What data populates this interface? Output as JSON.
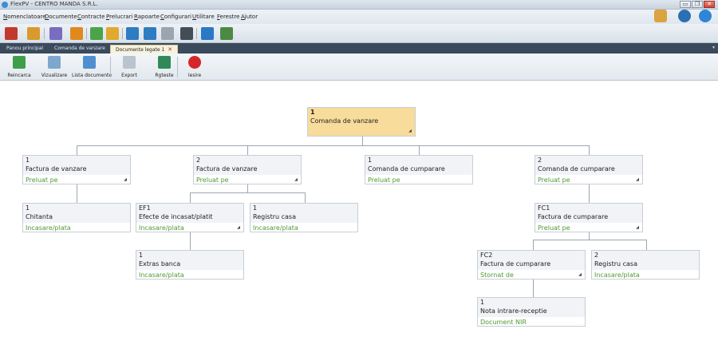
{
  "window": {
    "title": "FlexPV - CENTRO MANDA S.R.L.",
    "minimize": "▭",
    "maximize": "❐",
    "close": "✕"
  },
  "menu": [
    "Nomenclatoare",
    "Documente",
    "Contracte",
    "Prelucrari",
    "Rapoarte",
    "Configurari",
    "Utilitare",
    "Ferestre",
    "Ajutor"
  ],
  "tabs": [
    {
      "label": "Panou principal"
    },
    {
      "label": "Comanda de vanzare"
    },
    {
      "label": "Documente legate 1",
      "close": "✕"
    }
  ],
  "tab_arrow": "▾",
  "ribbon": [
    {
      "label": "Reincarca"
    },
    {
      "label": "Vizualizare"
    },
    {
      "label": "Lista documente"
    },
    {
      "label": "Export"
    },
    {
      "label": "Rgteste"
    },
    {
      "label": "Iesire"
    }
  ],
  "nodes": {
    "root": {
      "num": "1",
      "name": "Comanda de vanzare",
      "rel": ""
    },
    "fv1": {
      "num": "1",
      "name": "Factura de vanzare",
      "rel": "Preluat pe"
    },
    "fv2": {
      "num": "2",
      "name": "Factura de vanzare",
      "rel": "Preluat pe"
    },
    "cc1": {
      "num": "1",
      "name": "Comanda de cumparare",
      "rel": "Preluat pe"
    },
    "cc2": {
      "num": "2",
      "name": "Comanda de cumparare",
      "rel": "Preluat pe"
    },
    "chit": {
      "num": "1",
      "name": "Chitanta",
      "rel": "Incasare/plata"
    },
    "ef1": {
      "num": "EF1",
      "name": "Efecte de incasat/platit",
      "rel": "Incasare/plata"
    },
    "rc1": {
      "num": "1",
      "name": "Registru casa",
      "rel": "Incasare/plata"
    },
    "fc1": {
      "num": "FC1",
      "name": "Factura de cumparare",
      "rel": "Preluat pe"
    },
    "eb": {
      "num": "1",
      "name": "Extras banca",
      "rel": "Incasare/plata"
    },
    "fc2": {
      "num": "FC2",
      "name": "Factura de cumparare",
      "rel": "Stornat de"
    },
    "rc2": {
      "num": "2",
      "name": "Registru casa",
      "rel": "Incasare/plata"
    },
    "nir": {
      "num": "1",
      "name": "Nota intrare-receptie",
      "rel": "Document NIR"
    }
  }
}
